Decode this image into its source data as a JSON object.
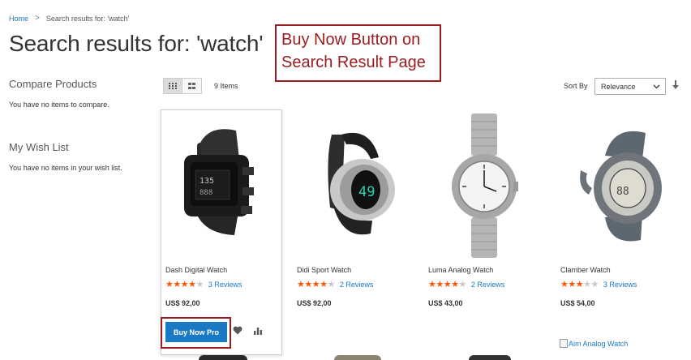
{
  "breadcrumb": {
    "home": "Home",
    "separator": ">",
    "current": "Search results for: 'watch'"
  },
  "page_title": "Search results for: 'watch'",
  "annotation": {
    "line1": "Buy Now Button on",
    "line2": "Search Result Page"
  },
  "sidebar": {
    "compare_title": "Compare Products",
    "compare_empty": "You have no items to compare.",
    "wishlist_title": "My Wish List",
    "wishlist_empty": "You have no items in your wish list."
  },
  "toolbar": {
    "items_count": "9 Items",
    "sort_label": "Sort By",
    "sort_value": "Relevance",
    "sort_caret": "⌄",
    "modes": [
      "grid-mode-icon",
      "list-mode-icon"
    ]
  },
  "products": [
    {
      "name": "Dash Digital Watch",
      "rating": 3.5,
      "stars_on": "★★★★",
      "stars_off": "★",
      "reviews": "3  Reviews",
      "price": "US$ 92,00"
    },
    {
      "name": "Didi Sport Watch",
      "rating": 3.5,
      "stars_on": "★★★★",
      "stars_off": "★",
      "reviews": "2  Reviews",
      "price": "US$ 92,00"
    },
    {
      "name": "Luma Analog Watch",
      "rating": 4,
      "stars_on": "★★★★",
      "stars_off": "★",
      "reviews": "2  Reviews",
      "price": "US$ 43,00"
    },
    {
      "name": "Clamber Watch",
      "rating": 2.5,
      "stars_on": "★★★",
      "stars_off": "★★",
      "reviews": "3  Reviews",
      "price": "US$ 54,00"
    }
  ],
  "buy_now_label": "Buy Now Pro",
  "broken_image_alt": "Aim Analog Watch",
  "colors": {
    "accent": "#1979c3",
    "annotation": "#9b1b1f",
    "star": "#ff5501"
  }
}
